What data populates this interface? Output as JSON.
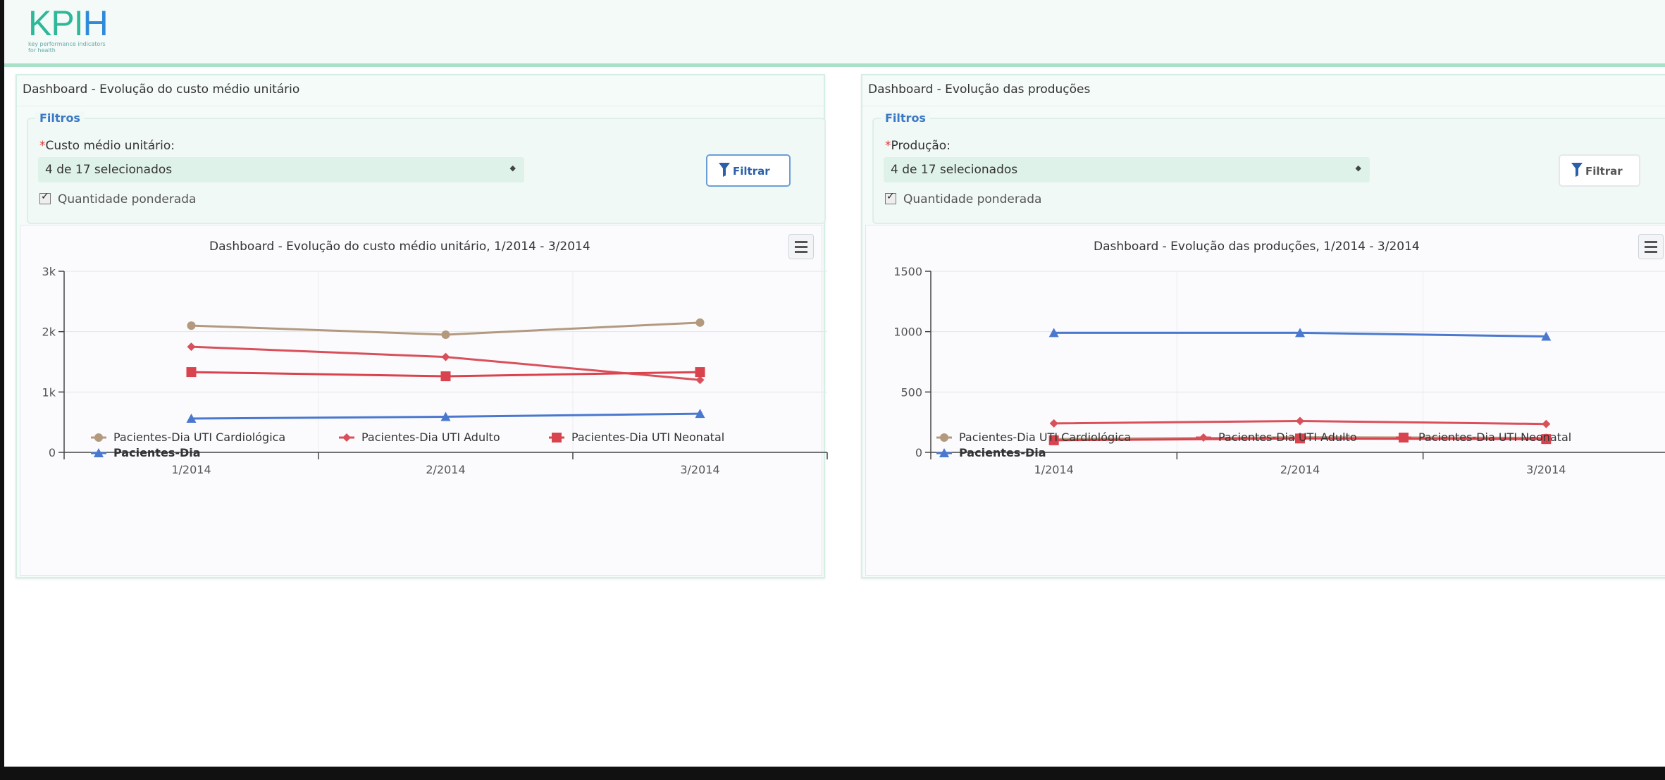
{
  "app": {
    "logo_text_main": "KPI",
    "logo_text_accent": "H",
    "logo_tagline": "key performance indicators for health"
  },
  "colors": {
    "cardiologica": "#b39a7f",
    "adulto": "#d9505a",
    "neonatal": "#d9434d",
    "pacientes_dia": "#4a78cf",
    "accent": "#2fb79a"
  },
  "panels": [
    {
      "title": "Dashboard - Evolução do custo médio unitário",
      "filters_legend": "Filtros",
      "required_mark": "*",
      "filter_label": "Custo médio unitário:",
      "select_value": "4 de 17 selecionados",
      "checkbox_label": "Quantidade ponderada",
      "checkbox_checked": true,
      "filter_button": "Filtrar",
      "chart_title": "Dashboard - Evolução do custo médio unitário, 1/2014 - 3/2014"
    },
    {
      "title": "Dashboard - Evolução das produções",
      "filters_legend": "Filtros",
      "required_mark": "*",
      "filter_label": "Produção:",
      "select_value": "4 de 17 selecionados",
      "checkbox_label": "Quantidade ponderada",
      "checkbox_checked": true,
      "filter_button": "Filtrar",
      "chart_title": "Dashboard - Evolução das produções, 1/2014 - 3/2014"
    }
  ],
  "chart_data": [
    {
      "type": "line",
      "title": "Dashboard - Evolução do custo médio unitário, 1/2014 - 3/2014",
      "x": [
        "1/2014",
        "2/2014",
        "3/2014"
      ],
      "ylim": [
        0,
        3000
      ],
      "yticks": [
        0,
        1000,
        2000,
        3000
      ],
      "ytick_labels": [
        "0",
        "1k",
        "2k",
        "3k"
      ],
      "grid": true,
      "legend": "bottom",
      "series": [
        {
          "name": "Pacientes-Dia UTI Cardiológica",
          "values": [
            2100,
            1950,
            2150
          ],
          "color": "#b39a7f",
          "marker": "circle"
        },
        {
          "name": "Pacientes-Dia UTI Adulto",
          "values": [
            1750,
            1580,
            1200
          ],
          "color": "#d9505a",
          "marker": "diamond"
        },
        {
          "name": "Pacientes-Dia UTI Neonatal",
          "values": [
            1330,
            1260,
            1330
          ],
          "color": "#d9434d",
          "marker": "square"
        },
        {
          "name": "Pacientes-Dia",
          "values": [
            560,
            590,
            640
          ],
          "color": "#4a78cf",
          "marker": "triangle"
        }
      ]
    },
    {
      "type": "line",
      "title": "Dashboard - Evolução das produções, 1/2014 - 3/2014",
      "x": [
        "1/2014",
        "2/2014",
        "3/2014"
      ],
      "ylim": [
        0,
        1500
      ],
      "yticks": [
        0,
        500,
        1000,
        1500
      ],
      "ytick_labels": [
        "0",
        "500",
        "1000",
        "1500"
      ],
      "grid": true,
      "legend": "bottom",
      "series": [
        {
          "name": "Pacientes-Dia UTI Cardiológica",
          "values": [
            110,
            125,
            120
          ],
          "color": "#b39a7f",
          "marker": "circle"
        },
        {
          "name": "Pacientes-Dia UTI Adulto",
          "values": [
            240,
            260,
            235
          ],
          "color": "#d9505a",
          "marker": "diamond"
        },
        {
          "name": "Pacientes-Dia UTI Neonatal",
          "values": [
            100,
            115,
            110
          ],
          "color": "#d9434d",
          "marker": "square"
        },
        {
          "name": "Pacientes-Dia",
          "values": [
            990,
            990,
            960
          ],
          "color": "#4a78cf",
          "marker": "triangle"
        }
      ]
    }
  ]
}
